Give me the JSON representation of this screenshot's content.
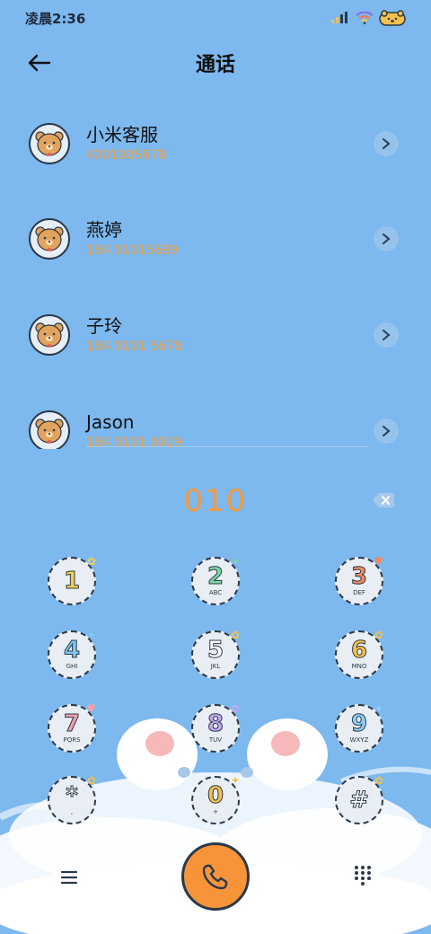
{
  "status_bar": {
    "time": "凌晨2:36",
    "signal_icon": "signal-icon",
    "wifi_icon": "wifi-icon",
    "battery_icon": "battery-bear-icon"
  },
  "header": {
    "title": "通话",
    "back_icon": "back-arrow-icon"
  },
  "contacts": [
    {
      "name": "小米客服",
      "number": "4001005678"
    },
    {
      "name": "燕婷",
      "number": "184 01015689"
    },
    {
      "name": "子玲",
      "number": "184 0101 5678"
    },
    {
      "name": "Jason",
      "number": "184 0101 0029"
    }
  ],
  "dialer": {
    "input": "010",
    "keys": [
      {
        "digit": "1",
        "letters": "",
        "color": "#f5d04c",
        "deco": "✿"
      },
      {
        "digit": "2",
        "letters": "ABC",
        "color": "#7fd6a2",
        "deco": "✦"
      },
      {
        "digit": "3",
        "letters": "DEF",
        "color": "#f08a60",
        "deco": "♥"
      },
      {
        "digit": "4",
        "letters": "GHI",
        "color": "#7ec8f0",
        "deco": "✦"
      },
      {
        "digit": "5",
        "letters": "JKL",
        "color": "#ffffff",
        "deco": "✿"
      },
      {
        "digit": "6",
        "letters": "MNO",
        "color": "#f5c04c",
        "deco": "✿"
      },
      {
        "digit": "7",
        "letters": "PQRS",
        "color": "#f5a0a8",
        "deco": "♥"
      },
      {
        "digit": "8",
        "letters": "TUV",
        "color": "#c4a6f2",
        "deco": "✿"
      },
      {
        "digit": "9",
        "letters": "WXYZ",
        "color": "#8cd0f5",
        "deco": "✦"
      },
      {
        "digit": "*",
        "letters": ",",
        "color": "#ffffff",
        "deco": "✿"
      },
      {
        "digit": "0",
        "letters": "+",
        "color": "#f5c04c",
        "deco": "✦"
      },
      {
        "digit": "#",
        "letters": "",
        "color": "#ffffff",
        "deco": "✿"
      }
    ]
  },
  "colors": {
    "background": "#7db8ee",
    "accent_number": "#f29a3e",
    "call_button": "#f7943a"
  }
}
